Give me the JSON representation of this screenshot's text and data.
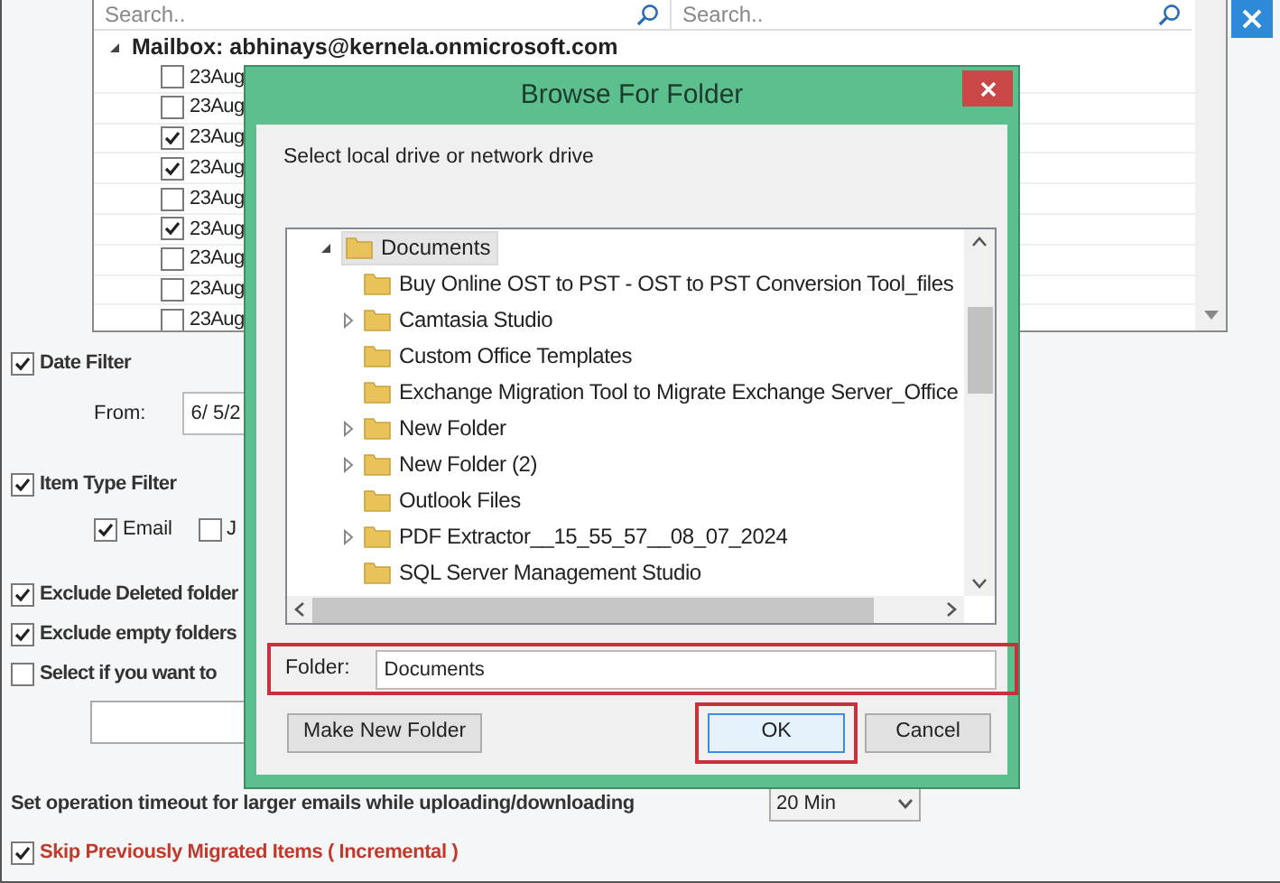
{
  "mailbox_panel": {
    "search_left": {
      "placeholder": "Search.."
    },
    "search_right": {
      "placeholder": "Search.."
    },
    "mailbox": {
      "label": "Mailbox: abhinays@kernela.onmicrosoft.com",
      "expanded": true
    },
    "items": [
      {
        "label": "23Aug",
        "checked": false
      },
      {
        "label": "23Aug",
        "checked": false
      },
      {
        "label": "23Aug",
        "checked": true
      },
      {
        "label": "23Aug",
        "checked": true
      },
      {
        "label": "23Aug",
        "checked": false
      },
      {
        "label": "23Aug",
        "checked": true
      },
      {
        "label": "23Aug",
        "checked": false
      },
      {
        "label": "23Aug",
        "checked": false
      },
      {
        "label": "23Aug",
        "checked": false
      }
    ]
  },
  "date_filter": {
    "label": "Date Filter",
    "checked": true,
    "from_label": "From:",
    "from_value": "6/ 5/2"
  },
  "item_type_filter": {
    "label": "Item Type Filter",
    "checked": true,
    "types": [
      {
        "label": "Email",
        "checked": true
      },
      {
        "label": "J",
        "checked": false
      }
    ]
  },
  "options": [
    {
      "label": "Exclude Deleted folder",
      "checked": true
    },
    {
      "label": "Exclude empty folders",
      "checked": true
    },
    {
      "label": "Select if you want to",
      "checked": false
    }
  ],
  "timeout": {
    "label": "Set operation timeout for larger emails while uploading/downloading",
    "value": "20 Min"
  },
  "incremental": {
    "label": "Skip Previously Migrated Items ( Incremental )",
    "checked": true
  },
  "dialog": {
    "title": "Browse For Folder",
    "instruction": "Select local drive or network drive",
    "tree": {
      "label": "Documents",
      "expanded": true,
      "selected": true,
      "children": [
        {
          "label": "Buy Online OST to PST - OST to PST Conversion Tool_files",
          "expandable": false,
          "selected": false
        },
        {
          "label": "Camtasia Studio",
          "expandable": true,
          "selected": false
        },
        {
          "label": "Custom Office Templates",
          "expandable": false,
          "selected": false
        },
        {
          "label": "Exchange Migration Tool to Migrate Exchange Server_Office",
          "expandable": false,
          "selected": false
        },
        {
          "label": "New Folder",
          "expandable": true,
          "selected": false
        },
        {
          "label": "New Folder (2)",
          "expandable": true,
          "selected": false
        },
        {
          "label": "Outlook Files",
          "expandable": false,
          "selected": false
        },
        {
          "label": "PDF Extractor__15_55_57__08_07_2024",
          "expandable": true,
          "selected": false
        },
        {
          "label": "SQL Server Management Studio",
          "expandable": false,
          "selected": false
        }
      ]
    },
    "folder_label": "Folder:",
    "folder_value": "Documents",
    "buttons": [
      {
        "label": "Make New Folder",
        "kind": "secondary"
      },
      {
        "label": "OK",
        "kind": "default"
      },
      {
        "label": "Cancel",
        "kind": "secondary"
      }
    ]
  }
}
